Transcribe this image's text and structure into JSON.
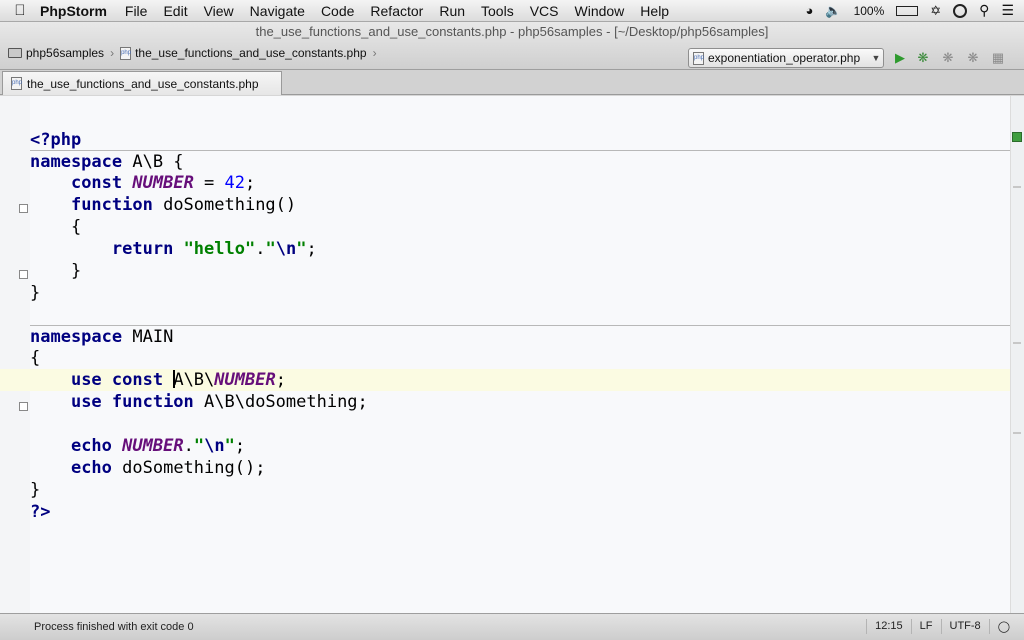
{
  "menubar": {
    "app": "PhpStorm",
    "items": [
      "File",
      "Edit",
      "View",
      "Navigate",
      "Code",
      "Refactor",
      "Run",
      "Tools",
      "VCS",
      "Window",
      "Help"
    ],
    "battery": "100%"
  },
  "window": {
    "title": "the_use_functions_and_use_constants.php - php56samples - [~/Desktop/php56samples]"
  },
  "breadcrumb": {
    "project": "php56samples",
    "file": "the_use_functions_and_use_constants.php"
  },
  "run_config": {
    "selected": "exponentiation_operator.php"
  },
  "tab": {
    "label": "the_use_functions_and_use_constants.php"
  },
  "status": {
    "message": "Process finished with exit code 0",
    "position": "12:15",
    "line_separator": "LF",
    "encoding": "UTF-8"
  },
  "colors": {
    "keyword": "#000080",
    "constant": "#660e7a",
    "number": "#0000ff",
    "string": "#008000",
    "current_line": "#fbfbe2"
  },
  "code": {
    "l1": "<?php",
    "l2_kw": "namespace",
    "l2_rest": " A\\B {",
    "l3_kw": "const",
    "l3_const": "NUMBER",
    "l3_eq": " = ",
    "l3_num": "42",
    "l3_end": ";",
    "l4_kw": "function",
    "l4_rest": " doSomething()",
    "l5": "{",
    "l6_kw": "return",
    "l6_s1": "\"hello\"",
    "l6_dot": ".",
    "l6_q1": "\"",
    "l6_esc": "\\n",
    "l6_q2": "\"",
    "l6_end": ";",
    "l7": "}",
    "l8": "}",
    "l10_kw": "namespace",
    "l10_rest": " MAIN",
    "l11": "{",
    "l12_kw": "use const",
    "l12_pre": "A\\B\\",
    "l12_const": "NUMBER",
    "l12_end": ";",
    "l13_kw": "use function",
    "l13_rest": " A\\B\\doSomething;",
    "l15_kw": "echo",
    "l15_const": "NUMBER",
    "l15_dot": ".",
    "l15_q1": "\"",
    "l15_esc": "\\n",
    "l15_q2": "\"",
    "l15_end": ";",
    "l16_kw": "echo",
    "l16_rest": " doSomething();",
    "l17": "}",
    "l18": "?>"
  }
}
